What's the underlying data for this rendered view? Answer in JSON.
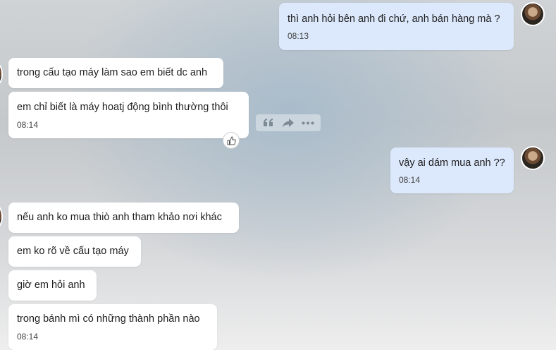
{
  "messages": [
    {
      "direction": "out",
      "text": "thì anh hỏi bên anh đi chứ, anh bán hàng mà ?",
      "time": "08:13"
    },
    {
      "direction": "in",
      "text": "trong cấu tạo máy làm sao em biết dc anh"
    },
    {
      "direction": "in",
      "text": "em chỉ biết là máy hoatj động bình thường thôi",
      "time": "08:14"
    },
    {
      "direction": "out",
      "text": "vậy ai dám mua anh ??",
      "time": "08:14"
    },
    {
      "direction": "in",
      "text": "nếu anh ko mua thiò anh tham khảo nơi khác"
    },
    {
      "direction": "in",
      "text": "em ko rõ về cấu tạo máy"
    },
    {
      "direction": "in",
      "text": "giờ em hỏi anh"
    },
    {
      "direction": "in",
      "text": "trong bánh mì có những thành phần nào",
      "time": "08:14"
    }
  ],
  "message_actions": {
    "icons": [
      "quote-icon",
      "forward-icon",
      "more-icon",
      "like-icon"
    ]
  },
  "colors": {
    "incoming_bubble": "#ffffff",
    "outgoing_bubble": "#dce8fb",
    "toolbar_icon": "#7d8994"
  }
}
